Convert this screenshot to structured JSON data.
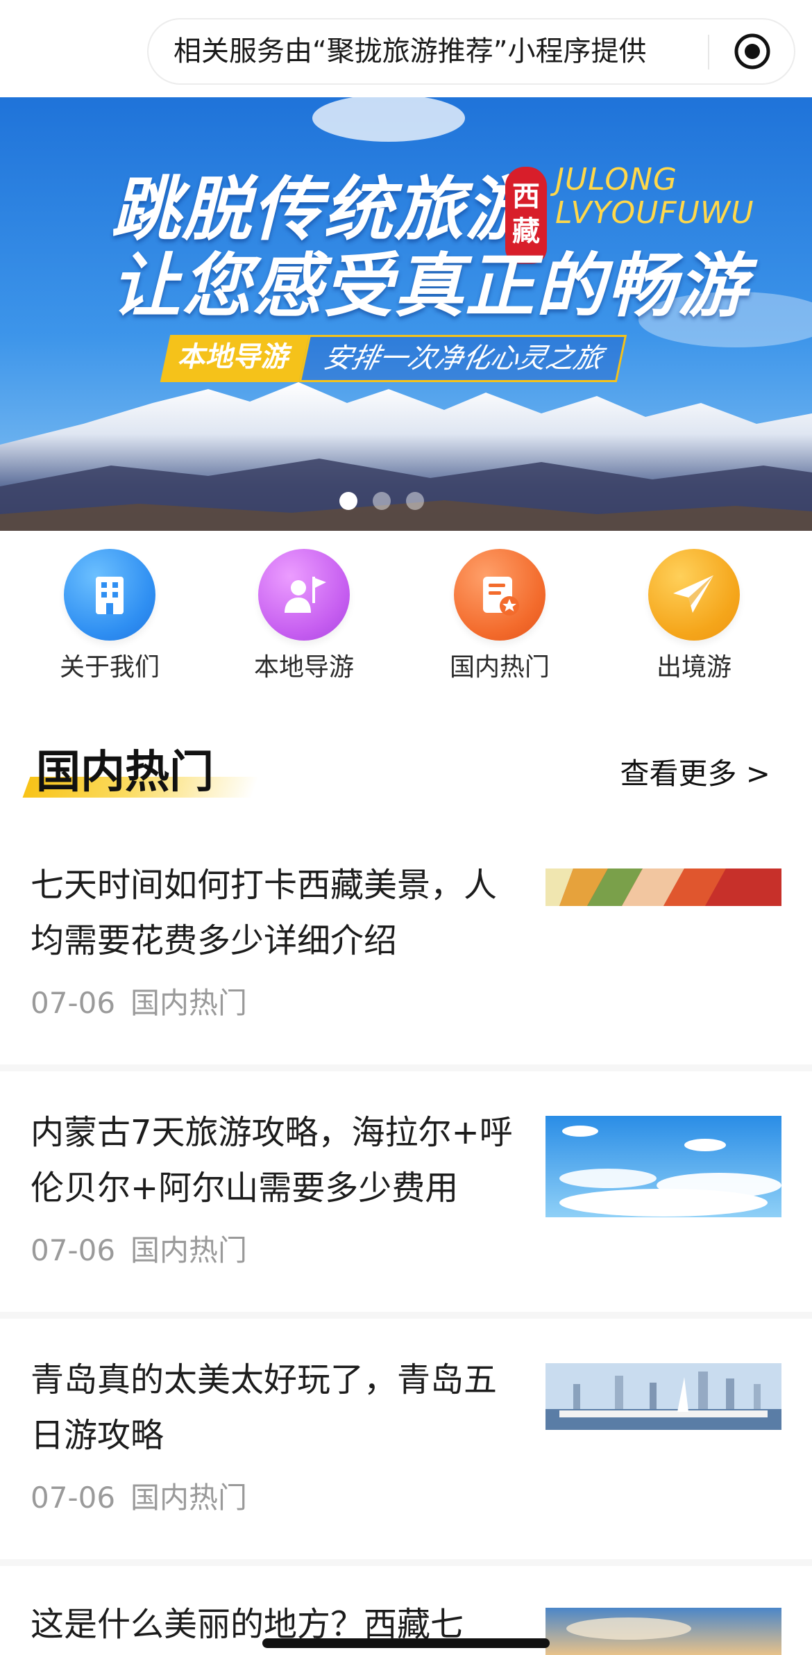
{
  "topbar": {
    "notice": "相关服务由“聚拢旅游推荐”小程序提供",
    "icon": "target-circle-icon"
  },
  "banner": {
    "line1": "跳脱传统旅游",
    "line2": "让您感受真正的畅游",
    "stamp": "西藏",
    "en_line1": "JULONG",
    "en_line2": "LVYOUFUWU",
    "tag_a": "本地导游",
    "tag_b": "安排一次净化心灵之旅",
    "dots_total": 3,
    "dots_active": 1
  },
  "nav": {
    "items": [
      {
        "label": "关于我们",
        "icon": "building-icon",
        "color": "#2f8ff2"
      },
      {
        "label": "本地导游",
        "icon": "guide-flag-icon",
        "color": "#c65ef0"
      },
      {
        "label": "国内热门",
        "icon": "list-star-icon",
        "color": "#f36b2c"
      },
      {
        "label": "出境游",
        "icon": "paper-plane-icon",
        "color": "#f5a61b"
      }
    ]
  },
  "section": {
    "title": "国内热门",
    "more": "查看更多 >"
  },
  "articles": [
    {
      "title": "七天时间如何打卡西藏美景，人均需要花费多少详细介绍",
      "date": "07-06",
      "category": "国内热门"
    },
    {
      "title": "内蒙古7天旅游攻略，海拉尔+呼伦贝尔+阿尔山需要多少费用",
      "date": "07-06",
      "category": "国内热门"
    },
    {
      "title": "青岛真的太美太好玩了，青岛五日游攻略",
      "date": "07-06",
      "category": "国内热门"
    },
    {
      "title": "这是什么美丽的地方？西藏七",
      "date": "",
      "category": ""
    }
  ]
}
